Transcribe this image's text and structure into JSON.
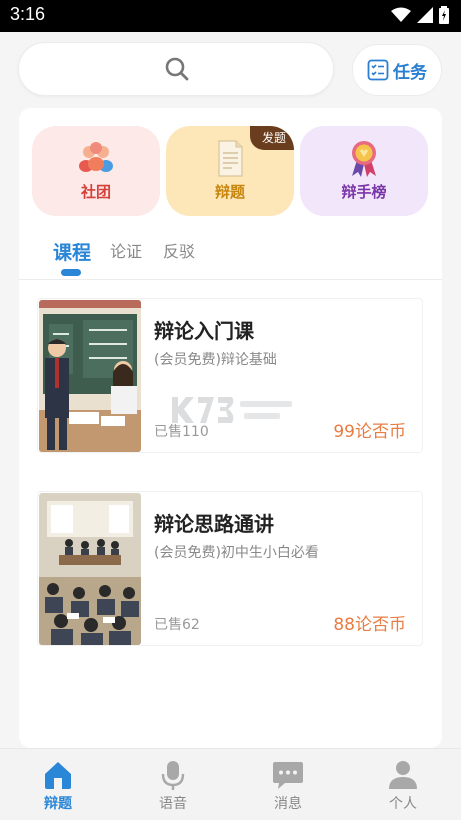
{
  "status_bar": {
    "time": "3:16"
  },
  "search": {
    "placeholder": ""
  },
  "task_button": {
    "label": "任务"
  },
  "categories": [
    {
      "label": "社团",
      "icon": "group-icon"
    },
    {
      "label": "辩题",
      "icon": "document-icon",
      "badge": "发题"
    },
    {
      "label": "辩手榜",
      "icon": "award-ribbon-icon"
    }
  ],
  "tabs": [
    {
      "label": "课程",
      "active": true
    },
    {
      "label": "论证",
      "active": false
    },
    {
      "label": "反驳",
      "active": false
    }
  ],
  "courses": [
    {
      "title": "辩论入门课",
      "subtitle": "(会员免费)辩论基础",
      "sold": "已售110",
      "price": "99论否币"
    },
    {
      "title": "辩论思路通讲",
      "subtitle": "(会员免费)初中生小白必看",
      "sold": "已售62",
      "price": "88论否币"
    }
  ],
  "bottom_nav": [
    {
      "label": "辩题",
      "icon": "home-icon",
      "active": true
    },
    {
      "label": "语音",
      "icon": "microphone-icon",
      "active": false
    },
    {
      "label": "消息",
      "icon": "chat-icon",
      "active": false
    },
    {
      "label": "个人",
      "icon": "person-icon",
      "active": false
    }
  ],
  "colors": {
    "accent": "#2a86d6",
    "price": "#e87d43"
  }
}
